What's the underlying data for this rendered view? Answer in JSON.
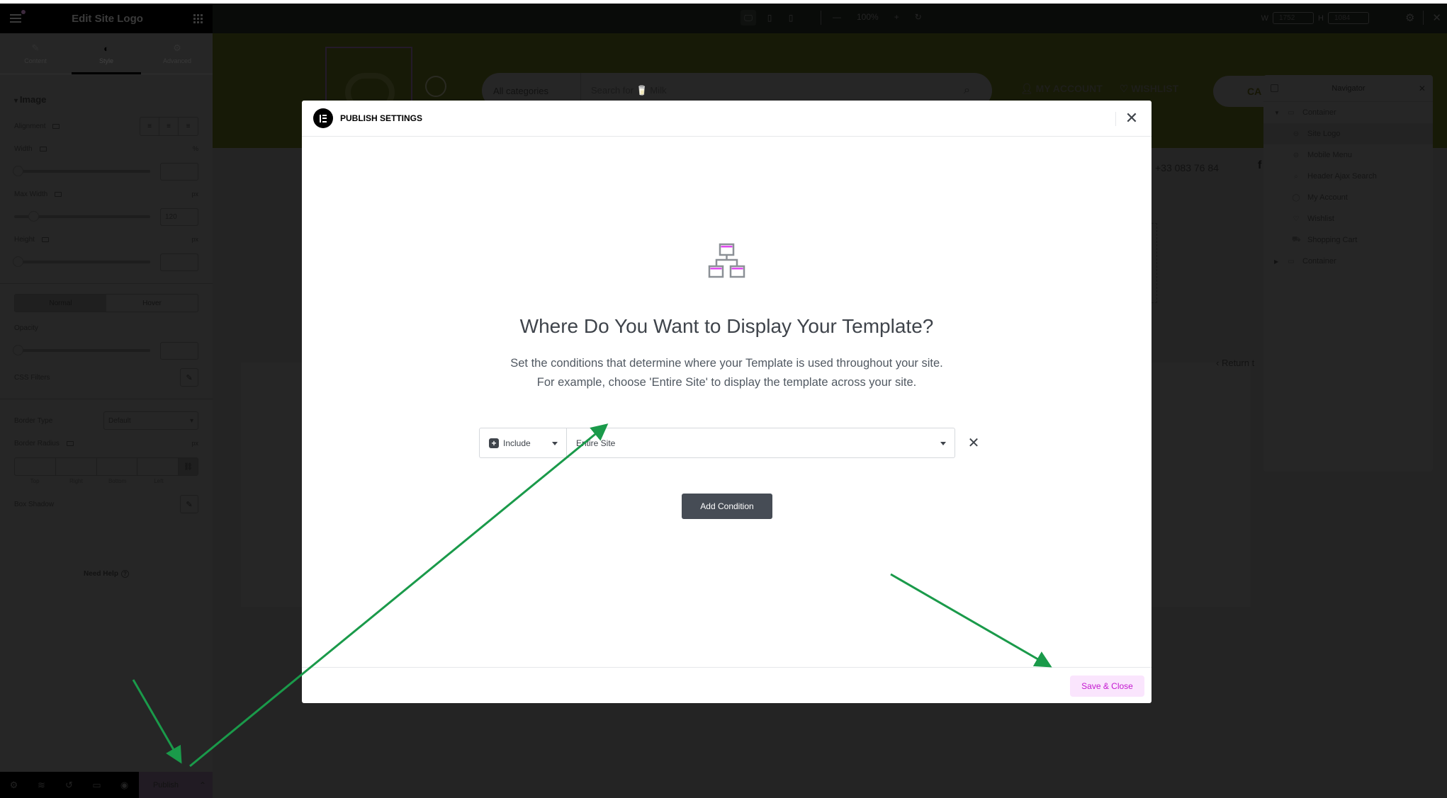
{
  "editor": {
    "panel_title": "Edit Site Logo",
    "tabs": [
      {
        "label": "Content",
        "icon": "pencil-icon"
      },
      {
        "label": "Style",
        "icon": "half-circle-icon",
        "active": true
      },
      {
        "label": "Advanced",
        "icon": "gear-icon"
      }
    ],
    "section": "Image",
    "controls": {
      "alignment": "Alignment",
      "width": "Width",
      "width_unit": "%",
      "max_width": "Max Width",
      "max_width_unit": "px",
      "max_width_value": "120",
      "height": "Height",
      "height_unit": "px",
      "normal": "Normal",
      "hover": "Hover",
      "opacity": "Opacity",
      "css_filters": "CSS Filters",
      "border_type": "Border Type",
      "border_type_value": "Default",
      "border_radius": "Border Radius",
      "border_radius_unit": "px",
      "br_top": "Top",
      "br_right": "Right",
      "br_bottom": "Bottom",
      "br_left": "Left",
      "box_shadow": "Box Shadow"
    },
    "need_help": "Need Help",
    "publish": "Publish"
  },
  "topbar": {
    "zoom": "100%",
    "width_label": "W",
    "width_value": "1752",
    "height_label": "H",
    "height_value": "1084"
  },
  "site": {
    "search_category": "All categories",
    "search_placeholder": "Search for 🥛 Milk",
    "my_account": "MY ACCOUNT",
    "wishlist": "WISHLIST",
    "cart": "CA",
    "phone": "+33 083 76 84",
    "return_text": "Return t"
  },
  "navigator": {
    "title": "Navigator",
    "items": [
      {
        "label": "Container",
        "level": 0,
        "expanded": true
      },
      {
        "label": "Site Logo",
        "level": 1,
        "selected": true
      },
      {
        "label": "Mobile Menu",
        "level": 1
      },
      {
        "label": "Header Ajax Search",
        "level": 1
      },
      {
        "label": "My Account",
        "level": 1
      },
      {
        "label": "Wishlist",
        "level": 1
      },
      {
        "label": "Shopping Cart",
        "level": 1
      },
      {
        "label": "Container",
        "level": 0,
        "expanded": false
      }
    ]
  },
  "modal": {
    "title": "PUBLISH SETTINGS",
    "heading": "Where Do You Want to Display Your Template?",
    "desc_line1": "Set the conditions that determine where your Template is used throughout your site.",
    "desc_line2": "For example, choose 'Entire Site' to display the template across your site.",
    "condition": {
      "type": "Include",
      "value": "Entire Site"
    },
    "add_condition": "Add Condition",
    "save_close": "Save & Close"
  },
  "colors": {
    "accent_pink": "#c418d0",
    "save_bg": "#fae5fd",
    "button_dark": "#464c55",
    "annotation_green": "#1a9a4a"
  }
}
